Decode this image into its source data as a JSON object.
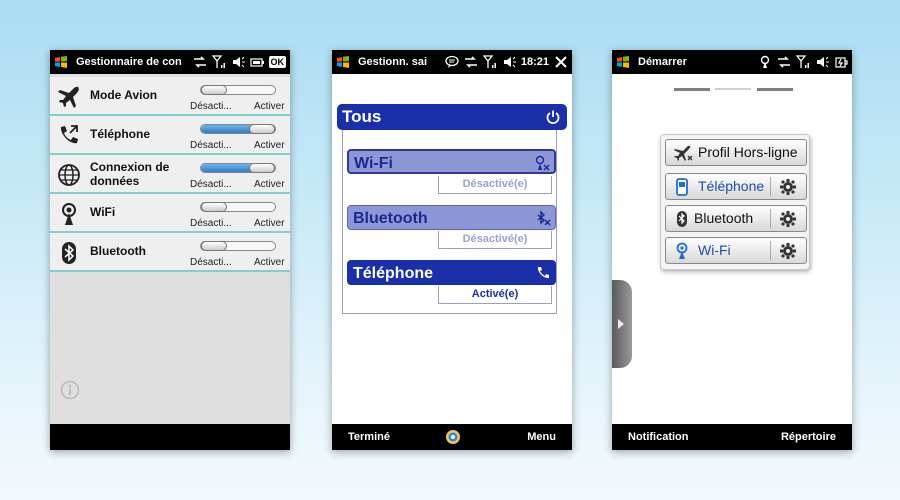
{
  "phone1": {
    "title": "Gestionnaire de con",
    "items": [
      {
        "label": "Mode Avion",
        "icon": "airplane-icon",
        "off_label": "Désacti...",
        "on_label": "Activer",
        "level": 0
      },
      {
        "label": "Téléphone",
        "icon": "phone-icon",
        "off_label": "Désacti...",
        "on_label": "Activer",
        "level": 1
      },
      {
        "label": "Connexion de données",
        "label_line1": "Connexion de",
        "label_line2": "données",
        "icon": "globe-icon",
        "off_label": "Désacti...",
        "on_label": "Activer",
        "level": 1
      },
      {
        "label": "WiFi",
        "icon": "wifi-antenna-icon",
        "off_label": "Désacti...",
        "on_label": "Activer",
        "level": 0
      },
      {
        "label": "Bluetooth",
        "icon": "bluetooth-icon",
        "off_label": "Désacti...",
        "on_label": "Activer",
        "level": 0
      }
    ]
  },
  "phone2": {
    "title": "Gestionn. sai",
    "time": "18:21",
    "header": "Tous",
    "items": [
      {
        "label": "Wi-Fi",
        "state": "Désactivé(e)"
      },
      {
        "label": "Bluetooth",
        "state": "Désactivé(e)"
      },
      {
        "label": "Téléphone",
        "state": "Activé(e)"
      }
    ],
    "softkey_left": "Terminé",
    "softkey_right": "Menu"
  },
  "phone3": {
    "title": "Démarrer",
    "menu": [
      {
        "label": "Profil Hors-ligne"
      },
      {
        "label": "Téléphone"
      },
      {
        "label": "Bluetooth"
      },
      {
        "label": "Wi-Fi"
      }
    ],
    "softkey_left": "Notification",
    "softkey_right": "Répertoire"
  },
  "colors": {
    "accent_blue": "#1b2fa8",
    "inactive_blue": "#8e97d6",
    "row_divider": "#7fd0c8"
  }
}
